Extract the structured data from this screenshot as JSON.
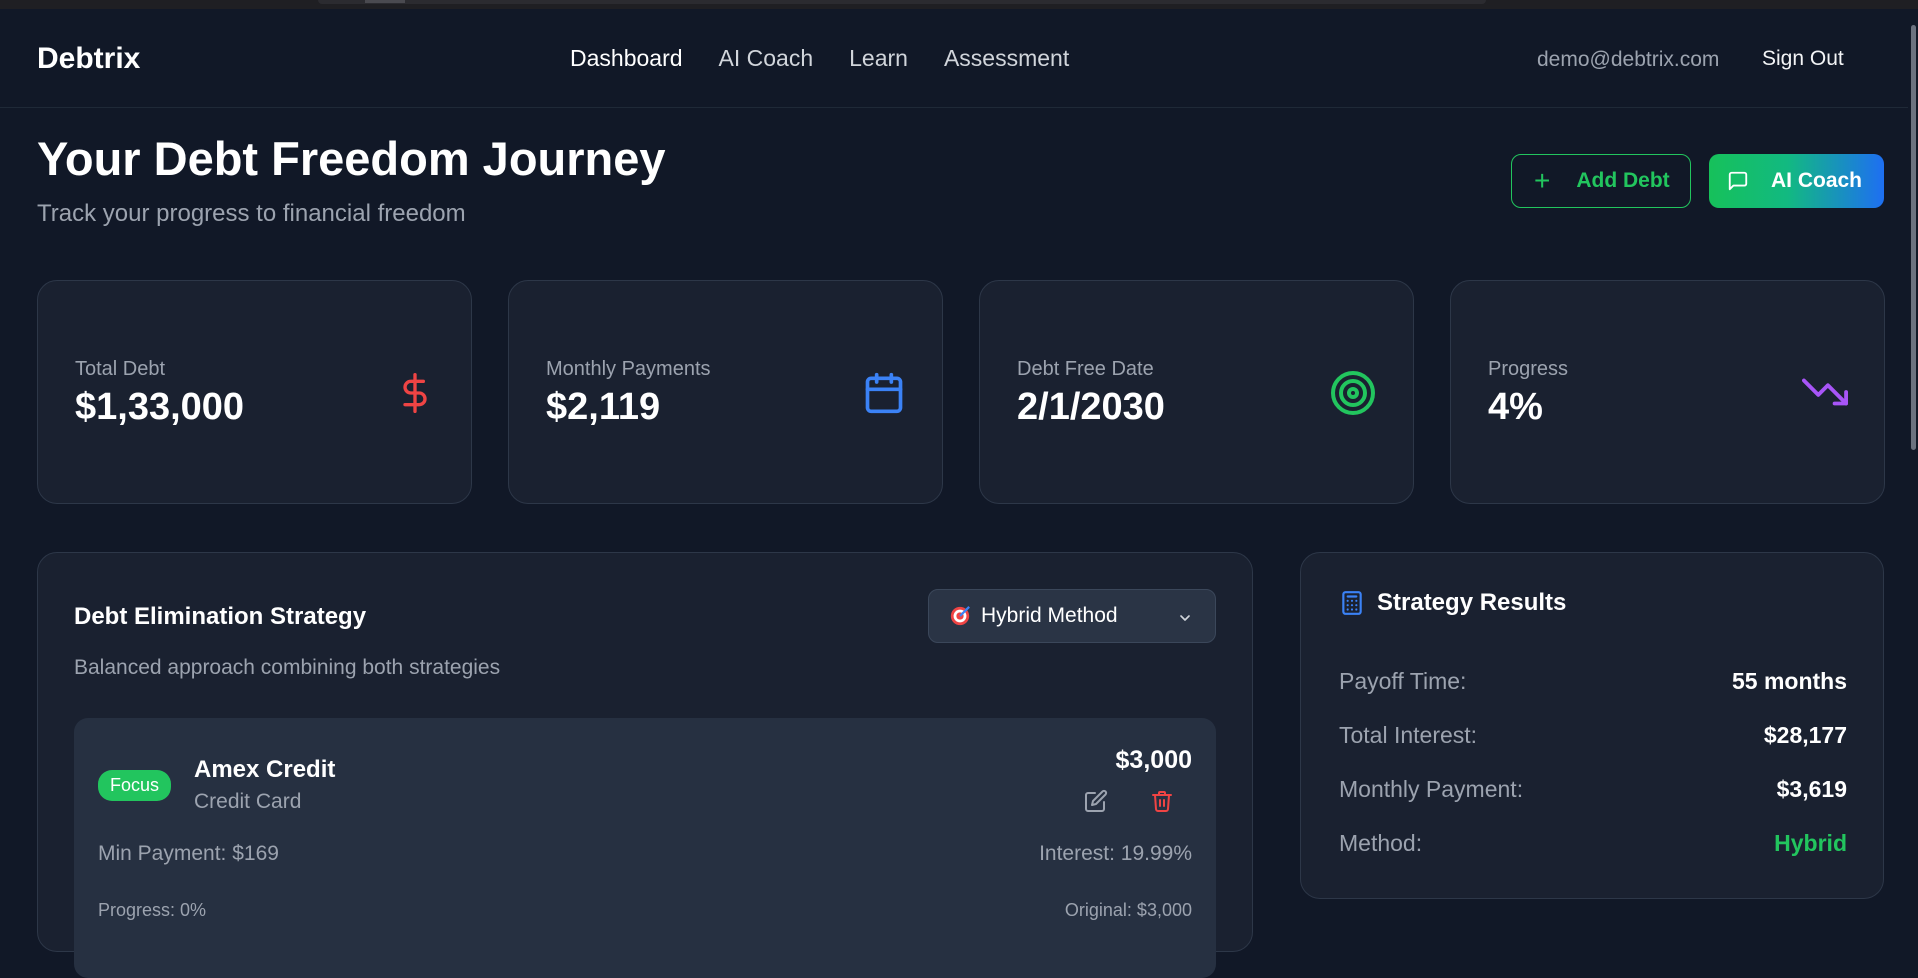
{
  "nav": {
    "brand": "Debtrix",
    "links": [
      "Dashboard",
      "AI Coach",
      "Learn",
      "Assessment"
    ],
    "active_index": 0,
    "email": "demo@debtrix.com",
    "sign_out": "Sign Out"
  },
  "header": {
    "title": "Your Debt Freedom Journey",
    "subtitle": "Track your progress to financial freedom",
    "add_debt_label": "Add Debt",
    "ai_coach_label": "AI Coach"
  },
  "stats": [
    {
      "label": "Total Debt",
      "value": "$1,33,000",
      "icon": "dollar-icon",
      "color": "#ef4444"
    },
    {
      "label": "Monthly Payments",
      "value": "$2,119",
      "icon": "calendar-icon",
      "color": "#3b82f6"
    },
    {
      "label": "Debt Free Date",
      "value": "2/1/2030",
      "icon": "target-icon",
      "color": "#22c55e"
    },
    {
      "label": "Progress",
      "value": "4%",
      "icon": "trending-down-icon",
      "color": "#a855f7"
    }
  ],
  "strategy": {
    "title": "Debt Elimination Strategy",
    "description": "Balanced approach combining both strategies",
    "selected_method": "Hybrid Method",
    "debt": {
      "badge": "Focus",
      "name": "Amex Credit",
      "type": "Credit Card",
      "amount": "$3,000",
      "min_payment": "Min Payment: $169",
      "interest": "Interest: 19.99%",
      "progress": "Progress: 0%",
      "original": "Original: $3,000"
    }
  },
  "results": {
    "title": "Strategy Results",
    "rows": [
      {
        "label": "Payoff Time:",
        "value": "55 months"
      },
      {
        "label": "Total Interest:",
        "value": "$28,177"
      },
      {
        "label": "Monthly Payment:",
        "value": "$3,619"
      },
      {
        "label": "Method:",
        "value": "Hybrid"
      }
    ]
  },
  "colors": {
    "accent_green": "#22c55e",
    "accent_blue": "#1e6ff2",
    "background": "#111827",
    "card": "#1a2130"
  }
}
